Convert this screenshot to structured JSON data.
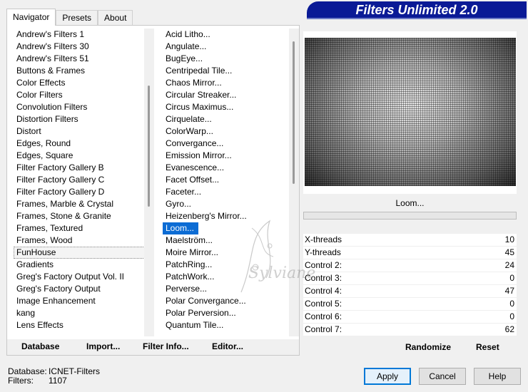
{
  "title": "Filters Unlimited 2.0",
  "tabs": [
    {
      "label": "Navigator",
      "active": true
    },
    {
      "label": "Presets",
      "active": false
    },
    {
      "label": "About",
      "active": false
    }
  ],
  "categories": [
    "Andrew's Filters 1",
    "Andrew's Filters 30",
    "Andrew's Filters 51",
    "Buttons & Frames",
    "Color Effects",
    "Color Filters",
    "Convolution Filters",
    "Distortion Filters",
    "Distort",
    "Edges, Round",
    "Edges, Square",
    "Filter Factory Gallery B",
    "Filter Factory Gallery C",
    "Filter Factory Gallery D",
    "Frames, Marble & Crystal",
    "Frames, Stone & Granite",
    "Frames, Textured",
    "Frames, Wood",
    "FunHouse",
    "Gradients",
    "Greg's Factory Output Vol. II",
    "Greg's Factory Output",
    "Image Enhancement",
    "kang",
    "Lens Effects"
  ],
  "selected_category": "FunHouse",
  "filters": [
    "Acid Litho...",
    "Angulate...",
    "BugEye...",
    "Centripedal Tile...",
    "Chaos Mirror...",
    "Circular Streaker...",
    "Circus Maximus...",
    "Cirquelate...",
    "ColorWarp...",
    "Convergance...",
    "Emission Mirror...",
    "Evanescence...",
    "Facet Offset...",
    "Faceter...",
    "Gyro...",
    "Heizenberg's Mirror...",
    "Loom...",
    "Maelström...",
    "Moire Mirror...",
    "PatchRing...",
    "PatchWork...",
    "Perverse...",
    "Polar Convergance...",
    "Polar Perversion...",
    "Quantum Tile..."
  ],
  "selected_filter": "Loom...",
  "nav_buttons": {
    "database": "Database",
    "import": "Import...",
    "filter_info": "Filter Info...",
    "editor": "Editor..."
  },
  "preview_filter_name": "Loom...",
  "controls": [
    {
      "label": "X-threads",
      "value": "10"
    },
    {
      "label": "Y-threads",
      "value": "45"
    },
    {
      "label": "Control 2:",
      "value": "24"
    },
    {
      "label": "Control 3:",
      "value": "0"
    },
    {
      "label": "Control 4:",
      "value": "47"
    },
    {
      "label": "Control 5:",
      "value": "0"
    },
    {
      "label": "Control 6:",
      "value": "0"
    },
    {
      "label": "Control 7:",
      "value": "62"
    }
  ],
  "randomize_label": "Randomize",
  "reset_label": "Reset",
  "status": {
    "database_label": "Database:",
    "database_value": "ICNET-Filters",
    "filters_label": "Filters:",
    "filters_value": "1107"
  },
  "dialog_buttons": {
    "apply": "Apply",
    "cancel": "Cancel",
    "help": "Help"
  },
  "watermark_text": "Sylviane"
}
